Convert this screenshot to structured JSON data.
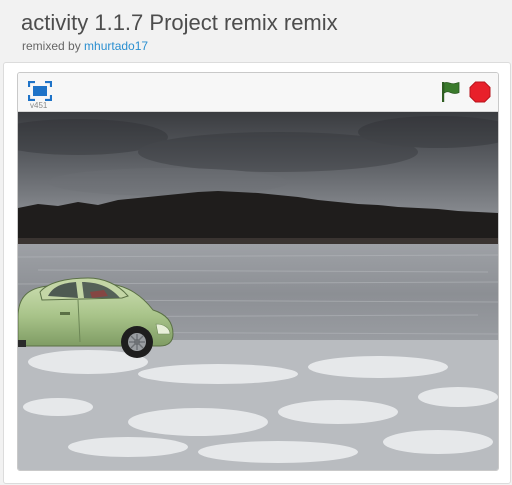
{
  "project": {
    "title": "activity 1.1.7 Project remix remix",
    "remixed_prefix": "remixed by",
    "remixed_by": "mhurtado17"
  },
  "player": {
    "version": "v451",
    "fullscreen_icon": "fullscreen-icon",
    "flag_icon": "green-flag-icon",
    "stop_icon": "stop-sign-icon",
    "colors": {
      "flag": "#3a7a2c",
      "stop": "#e8202a",
      "fullscreen": "#1e73c8"
    }
  },
  "stage": {
    "backdrop": "frozen lake under cloudy sky",
    "sprite": "green car"
  }
}
